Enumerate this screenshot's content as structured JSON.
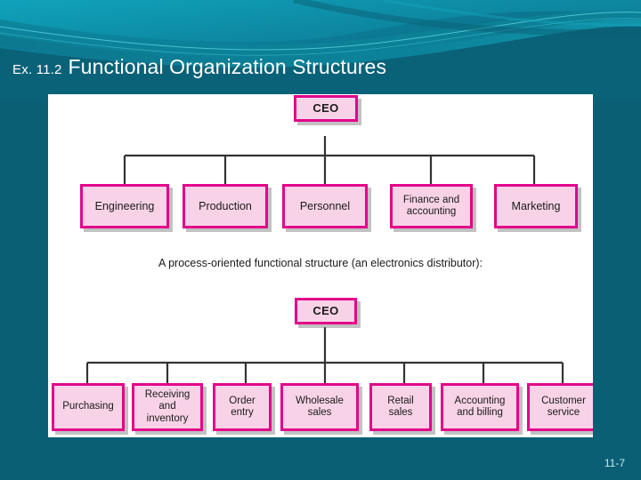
{
  "slide": {
    "background_color": "#0a5f75",
    "accent_light": "#17a0b8",
    "box_fill": "#f8d3e8",
    "box_border": "#e2058a"
  },
  "title": {
    "prefix": "Ex. 11.2",
    "main": "Functional Organization Structures"
  },
  "figure": {
    "caption": "A process-oriented functional structure (an electronics distributor):",
    "tree_top": {
      "root": "CEO",
      "children": [
        "Engineering",
        "Production",
        "Personnel",
        "Finance and accounting",
        "Marketing"
      ]
    },
    "tree_bottom": {
      "root": "CEO",
      "children": [
        "Purchasing",
        "Receiving and inventory",
        "Order entry",
        "Wholesale sales",
        "Retail sales",
        "Accounting and billing",
        "Customer service"
      ]
    }
  },
  "footer": {
    "page_number": "11-7"
  }
}
